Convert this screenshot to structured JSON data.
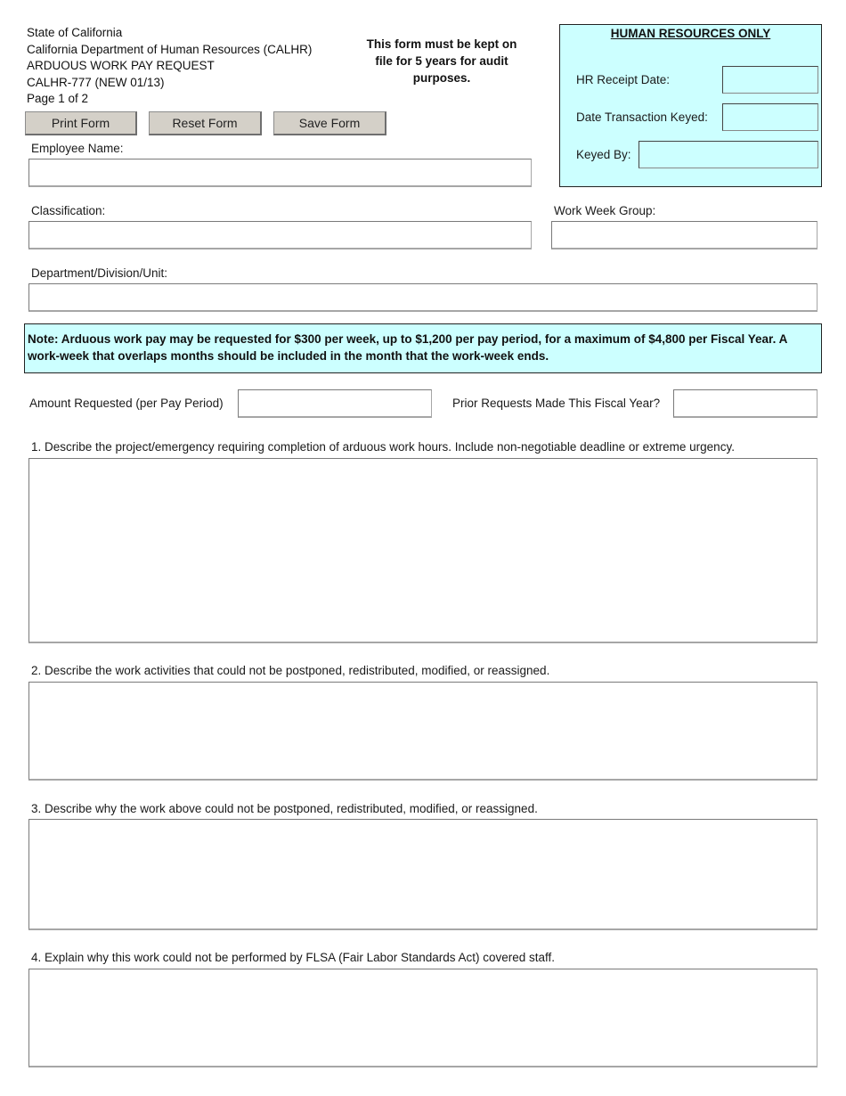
{
  "header": {
    "lines": [
      "State of California",
      "California Department of Human Resources (CALHR)",
      "ARDUOUS WORK PAY REQUEST",
      "CALHR-777 (NEW 01/13)",
      "Page 1 of 2"
    ],
    "retention_notice": "This form must be kept on file for 5 years for audit purposes."
  },
  "toolbar": {
    "print_label": "Print Form",
    "reset_label": "Reset Form",
    "save_label": "Save Form"
  },
  "hr_only": {
    "title": "HUMAN RESOURCES ONLY",
    "receipt_date_label": "HR Receipt Date:",
    "receipt_date_value": "",
    "date_keyed_label": "Date Transaction Keyed:",
    "date_keyed_value": "",
    "keyed_by_label": "Keyed By:",
    "keyed_by_value": ""
  },
  "employee": {
    "name_label": "Employee Name:",
    "name_value": "",
    "classification_label": "Classification:",
    "classification_value": "",
    "work_week_group_label": "Work Week Group:",
    "work_week_group_value": "",
    "department_label": "Department/Division/Unit:",
    "department_value": ""
  },
  "note": {
    "text": "Note: Arduous work pay may be requested for $300 per week, up to $1,200 per pay period, for a maximum of $4,800 per Fiscal Year.  A work-week that overlaps months should be included in the month that the work-week ends."
  },
  "request": {
    "amount_label": "Amount Requested (per Pay Period)",
    "amount_value": "",
    "prior_label": "Prior Requests Made This Fiscal Year?",
    "prior_value": ""
  },
  "questions": [
    {
      "label": "1. Describe the project/emergency requiring completion of arduous work hours. Include non-negotiable deadline or extreme urgency.",
      "value": ""
    },
    {
      "label": "2. Describe the work activities that could not be postponed, redistributed, modified, or reassigned.",
      "value": ""
    },
    {
      "label": "3. Describe why the work above could not be postponed, redistributed, modified, or reassigned.",
      "value": ""
    },
    {
      "label": "4. Explain why this work could not be performed by FLSA (Fair Labor Standards Act) covered staff.",
      "value": ""
    }
  ],
  "colors": {
    "highlight_bg": "#ccffff",
    "button_bg": "#d4d0c8"
  }
}
